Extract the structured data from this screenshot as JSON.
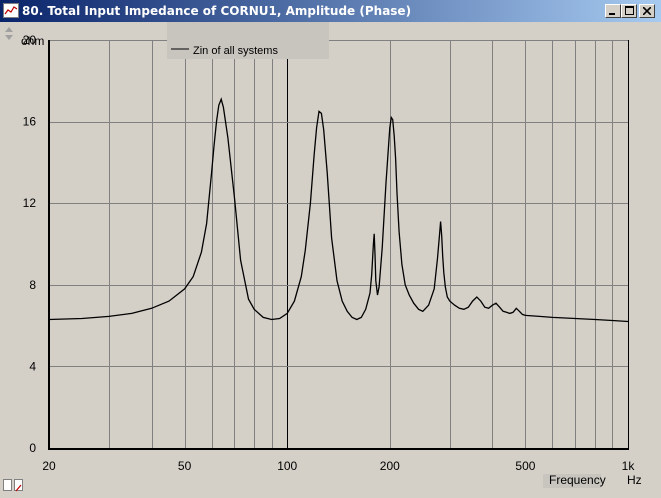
{
  "window": {
    "title": "80. Total Input Impedance of CORNU1, Amplitude (Phase)",
    "minimize_icon": "minimize-icon",
    "maximize_icon": "maximize-icon",
    "close_icon": "close-icon"
  },
  "colors": {
    "title_bar": "#0a246a",
    "background": "#d4d0c8",
    "legend_background": "#c8c5bf",
    "curve": "#000000",
    "grid": "#808080"
  },
  "chart_data": {
    "type": "line",
    "title": "",
    "xlabel": "Frequency",
    "xunit": "Hz",
    "ylabel": "ohm",
    "x_scale": "log",
    "xlim": [
      20,
      1000
    ],
    "ylim": [
      0,
      20
    ],
    "y_ticks": [
      "0",
      "4",
      "8",
      "12",
      "16",
      "20"
    ],
    "x_tick_labels": [
      {
        "value": 20,
        "label": "20"
      },
      {
        "value": 50,
        "label": "50"
      },
      {
        "value": 100,
        "label": "100"
      },
      {
        "value": 200,
        "label": "200"
      },
      {
        "value": 500,
        "label": "500"
      },
      {
        "value": 1000,
        "label": "1k"
      }
    ],
    "grid": true,
    "legend_position": "top-left",
    "series": [
      {
        "name": "Zin of all systems",
        "x": [
          20,
          25,
          30,
          35,
          40,
          45,
          50,
          53,
          56,
          58,
          60,
          61,
          62,
          63,
          64,
          65,
          67,
          70,
          73,
          77,
          80,
          85,
          90,
          95,
          100,
          105,
          110,
          113,
          117,
          120,
          122,
          124,
          126,
          128,
          131,
          135,
          140,
          145,
          150,
          155,
          160,
          165,
          170,
          175,
          177,
          179,
          180,
          181,
          182,
          184,
          186,
          190,
          195,
          200,
          202,
          204,
          206,
          208,
          210,
          213,
          217,
          222,
          228,
          235,
          243,
          250,
          260,
          270,
          276,
          280,
          282,
          284,
          286,
          288,
          291,
          295,
          300,
          310,
          320,
          330,
          340,
          350,
          360,
          370,
          380,
          390,
          400,
          410,
          420,
          430,
          440,
          450,
          460,
          470,
          480,
          490,
          500,
          550,
          600,
          700,
          800,
          900,
          1000
        ],
        "y": [
          6.3,
          6.35,
          6.45,
          6.6,
          6.85,
          7.2,
          7.8,
          8.4,
          9.6,
          11.0,
          13.5,
          14.8,
          16.0,
          16.8,
          17.1,
          16.7,
          15.2,
          12.3,
          9.2,
          7.3,
          6.8,
          6.4,
          6.3,
          6.35,
          6.6,
          7.2,
          8.4,
          9.7,
          12.0,
          14.4,
          15.7,
          16.5,
          16.4,
          15.6,
          13.5,
          10.3,
          8.2,
          7.2,
          6.7,
          6.4,
          6.3,
          6.4,
          6.8,
          7.6,
          8.5,
          10.0,
          10.5,
          9.5,
          8.2,
          7.5,
          7.9,
          9.8,
          13.0,
          15.7,
          16.2,
          16.1,
          15.3,
          14.2,
          12.5,
          10.6,
          9.0,
          8.0,
          7.5,
          7.1,
          6.8,
          6.7,
          7.0,
          7.8,
          9.3,
          10.5,
          11.1,
          10.4,
          9.4,
          8.6,
          7.9,
          7.4,
          7.2,
          7.0,
          6.85,
          6.8,
          6.9,
          7.2,
          7.4,
          7.2,
          6.9,
          6.85,
          7.0,
          7.1,
          6.9,
          6.7,
          6.65,
          6.6,
          6.65,
          6.85,
          6.7,
          6.55,
          6.5,
          6.45,
          6.4,
          6.35,
          6.3,
          6.25,
          6.2
        ]
      }
    ]
  }
}
